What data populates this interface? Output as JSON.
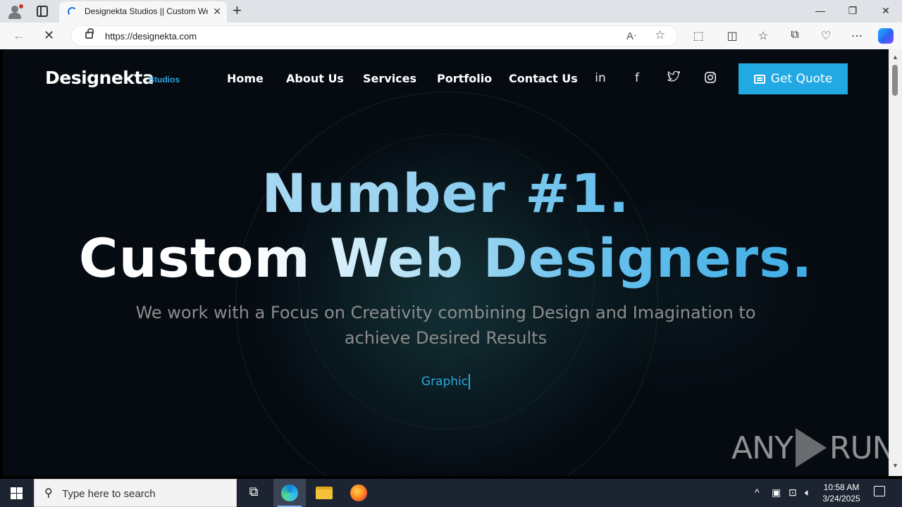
{
  "browser": {
    "tab_title": "Designekta Studios || Custom Web Designers",
    "tab_close": "✕",
    "new_tab": "+",
    "url": "https://designekta.com",
    "window": {
      "minimize": "—",
      "restore": "❐",
      "close": "✕"
    }
  },
  "site": {
    "logo": "Designekta",
    "logo_sub": "Studios",
    "nav": [
      "Home",
      "About Us",
      "Services",
      "Portfolio",
      "Contact Us"
    ],
    "social": {
      "linkedin": "in",
      "facebook": "f"
    },
    "cta": "Get Quote"
  },
  "hero": {
    "line1": "Number #1.",
    "line2": "Custom Web Designers.",
    "subtitle": "We work with a Focus on Creativity combining Design and Imagination to achieve Desired Results",
    "typed": "Graphic"
  },
  "watermark": {
    "left": "ANY",
    "right": "RUN"
  },
  "taskbar": {
    "search_placeholder": "Type here to search",
    "time": "10:58 AM",
    "date": "3/24/2025"
  },
  "colors": {
    "accent": "#22a9e3",
    "background": "#060b12"
  }
}
